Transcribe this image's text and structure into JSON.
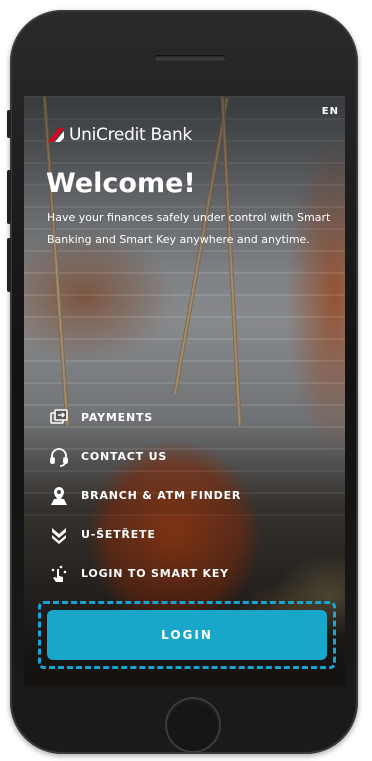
{
  "language_toggle": "EN",
  "brand": {
    "name": "UniCredit Bank",
    "logo_color": "#e2001a",
    "logo_icon": "unicredit-logo-icon"
  },
  "welcome": {
    "title": "Welcome!",
    "text": "Have your finances safely under control with Smart Banking and Smart Key anywhere and anytime."
  },
  "menu": {
    "items": [
      {
        "label": "PAYMENTS",
        "icon": "payments-icon"
      },
      {
        "label": "CONTACT US",
        "icon": "headset-icon"
      },
      {
        "label": "BRANCH & ATM FINDER",
        "icon": "map-pin-icon"
      },
      {
        "label": "U-ŠETŘETE",
        "icon": "savings-chevron-icon"
      },
      {
        "label": "LOGIN TO SMART KEY",
        "icon": "smart-key-touch-icon"
      }
    ]
  },
  "login": {
    "label": "LOGIN",
    "color": "#18a6c9"
  }
}
